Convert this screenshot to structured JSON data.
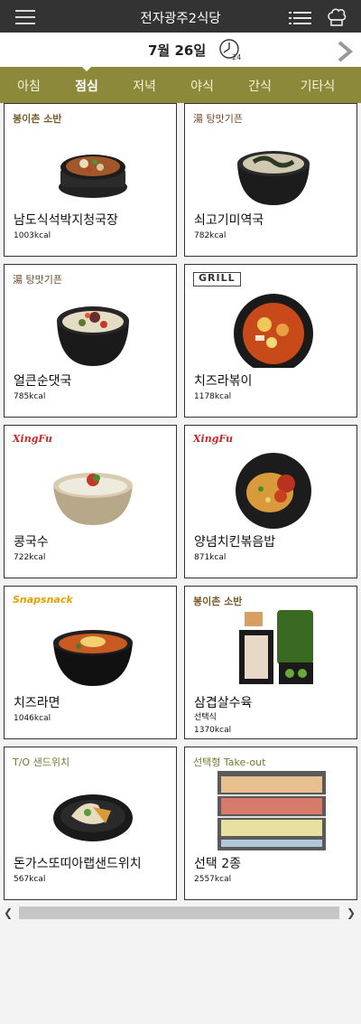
{
  "header": {
    "title": "전자광주2식당",
    "date": "7월 26일",
    "clock_badge": "24"
  },
  "icons": {
    "menu": "hamburger-menu-icon",
    "list": "list-icon",
    "chef": "chef-hat-icon",
    "clock": "24-hour-clock-icon",
    "next": "chevron-right-icon"
  },
  "tabs": [
    {
      "label": "아침"
    },
    {
      "label": "점심",
      "active": true
    },
    {
      "label": "저녁"
    },
    {
      "label": "야식"
    },
    {
      "label": "간식"
    },
    {
      "label": "기타식"
    }
  ],
  "colors": {
    "topbar": "#333333",
    "tabs": "#8c8a3a",
    "brand_olive": "#7b7530"
  },
  "menu_items": [
    {
      "brand": "봉이촌 소반",
      "name": "남도식석박지청국장",
      "kcal": "1003kcal"
    },
    {
      "brand": "湯 탕맛기픈",
      "name": "쇠고기미역국",
      "kcal": "782kcal"
    },
    {
      "brand": "湯 탕맛기픈",
      "name": "얼큰순댓국",
      "kcal": "785kcal"
    },
    {
      "brand": "GRILL",
      "name": "치즈라볶이",
      "kcal": "1178kcal"
    },
    {
      "brand": "XingFu",
      "name": "콩국수",
      "kcal": "722kcal"
    },
    {
      "brand": "XingFu",
      "name": "양념치킨볶음밥",
      "kcal": "871kcal"
    },
    {
      "brand": "Snapsnack",
      "name": "치즈라면",
      "kcal": "1046kcal"
    },
    {
      "brand": "봉이촌 소반",
      "name": "삼겹살수육",
      "sub": "선택식",
      "kcal": "1370kcal"
    },
    {
      "brand": "T/O 샌드위치",
      "name": "돈가스또띠아랩샌드위치",
      "kcal": "567kcal"
    },
    {
      "brand": "선택형 Take-out",
      "name": "선택 2종",
      "kcal": "2557kcal"
    }
  ]
}
